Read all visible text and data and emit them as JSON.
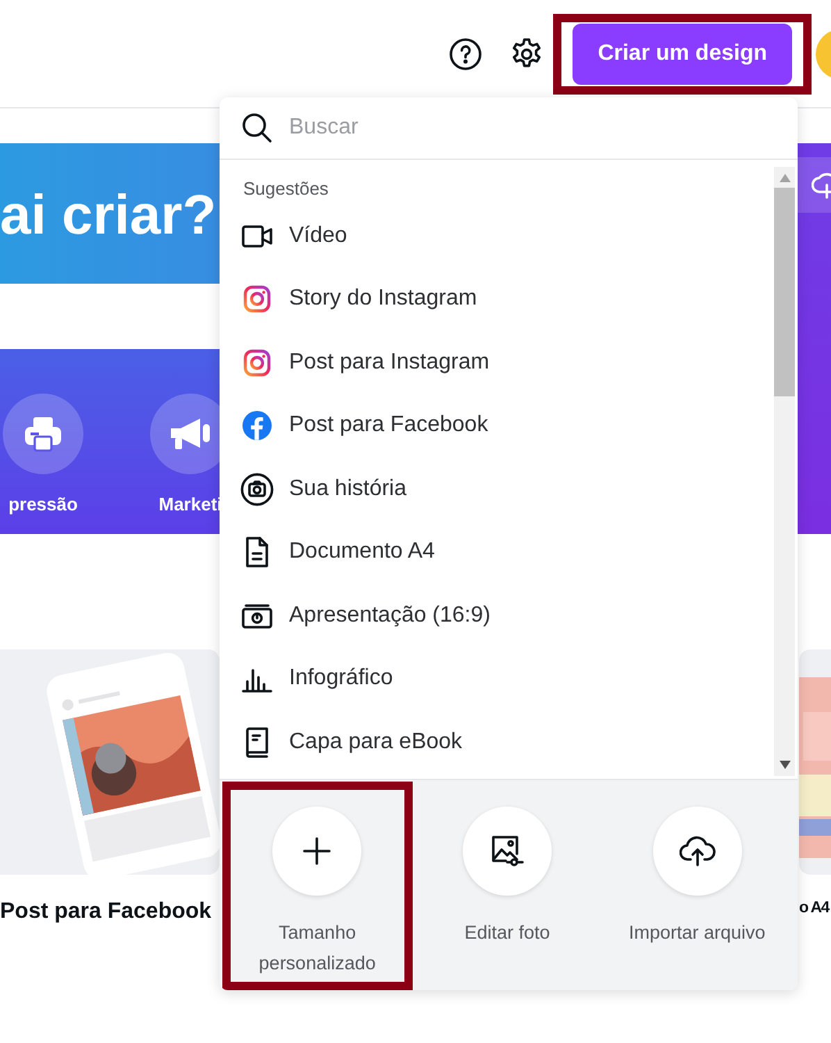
{
  "header": {
    "create_button": {
      "label": "Criar um design",
      "highlighted": true
    }
  },
  "banner": {
    "title": "ai criar?"
  },
  "categories": [
    {
      "kind": "printer",
      "label": "pressão"
    },
    {
      "kind": "megaphone",
      "label": "Marketi"
    }
  ],
  "cards": [
    {
      "label": "Post para Facebook"
    },
    {
      "label": "o A4"
    }
  ],
  "dropdown": {
    "search": {
      "placeholder": "Buscar"
    },
    "section": "Sugestões",
    "items": [
      {
        "kind": "video",
        "label": "Vídeo"
      },
      {
        "kind": "instagram",
        "label": "Story do Instagram"
      },
      {
        "kind": "instagram",
        "label": "Post para Instagram"
      },
      {
        "kind": "facebook",
        "label": "Post para Facebook"
      },
      {
        "kind": "story",
        "label": "Sua história"
      },
      {
        "kind": "document",
        "label": "Documento A4"
      },
      {
        "kind": "presentation",
        "label": "Apresentação (16:9)"
      },
      {
        "kind": "chart",
        "label": "Infográfico"
      },
      {
        "kind": "book",
        "label": "Capa para eBook"
      }
    ],
    "actions": [
      {
        "kind": "plus",
        "label": "Tamanho personalizado",
        "highlighted": true
      },
      {
        "label": "Editar foto",
        "highlighted": false
      },
      {
        "kind": "upload",
        "label": "Importar arquivo",
        "highlighted": false
      }
    ]
  }
}
